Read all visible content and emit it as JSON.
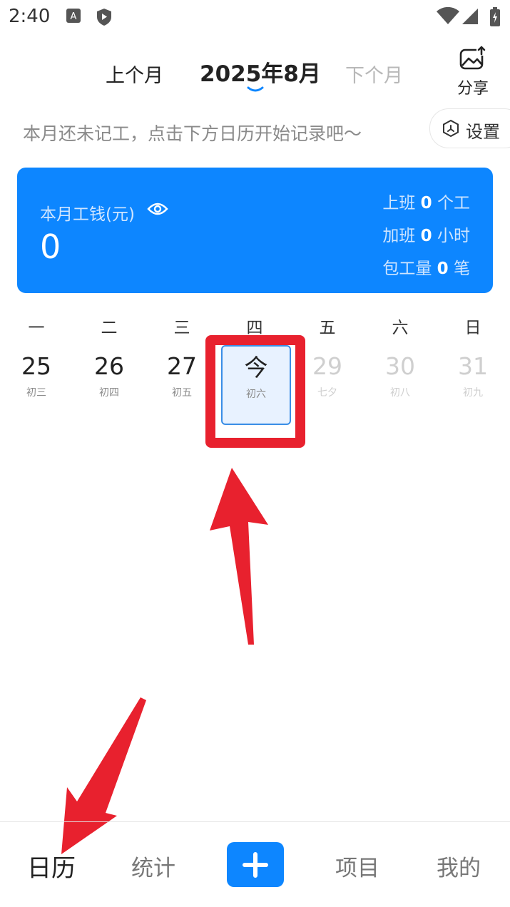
{
  "status_bar": {
    "time": "2:40"
  },
  "header": {
    "prev_month": "上个月",
    "current_month": "2025年8月",
    "next_month": "下个月",
    "share_label": "分享"
  },
  "hint": {
    "text": "本月还未记工，点击下方日历开始记录吧～",
    "settings_label": "设置"
  },
  "summary_card": {
    "wage_label": "本月工钱(元)",
    "wage_value": "0",
    "work_label": "上班",
    "work_value": "0",
    "work_unit": "个工",
    "overtime_label": "加班",
    "overtime_value": "0",
    "overtime_unit": "小时",
    "contract_label": "包工量",
    "contract_value": "0",
    "contract_unit": "笔",
    "color": "#0d86ff"
  },
  "calendar": {
    "weekdays": [
      "一",
      "二",
      "三",
      "四",
      "五",
      "六",
      "日"
    ],
    "days": [
      {
        "num": "25",
        "lunar": "初三"
      },
      {
        "num": "26",
        "lunar": "初四"
      },
      {
        "num": "27",
        "lunar": "初五"
      },
      {
        "num": "今",
        "lunar": "初六"
      },
      {
        "num": "29",
        "lunar": "七夕"
      },
      {
        "num": "30",
        "lunar": "初八"
      },
      {
        "num": "31",
        "lunar": "初九"
      }
    ]
  },
  "bottom_nav": {
    "calendar": "日历",
    "stats": "统计",
    "projects": "项目",
    "mine": "我的"
  },
  "colors": {
    "accent": "#0d86ff",
    "annotation": "#e8212e"
  }
}
